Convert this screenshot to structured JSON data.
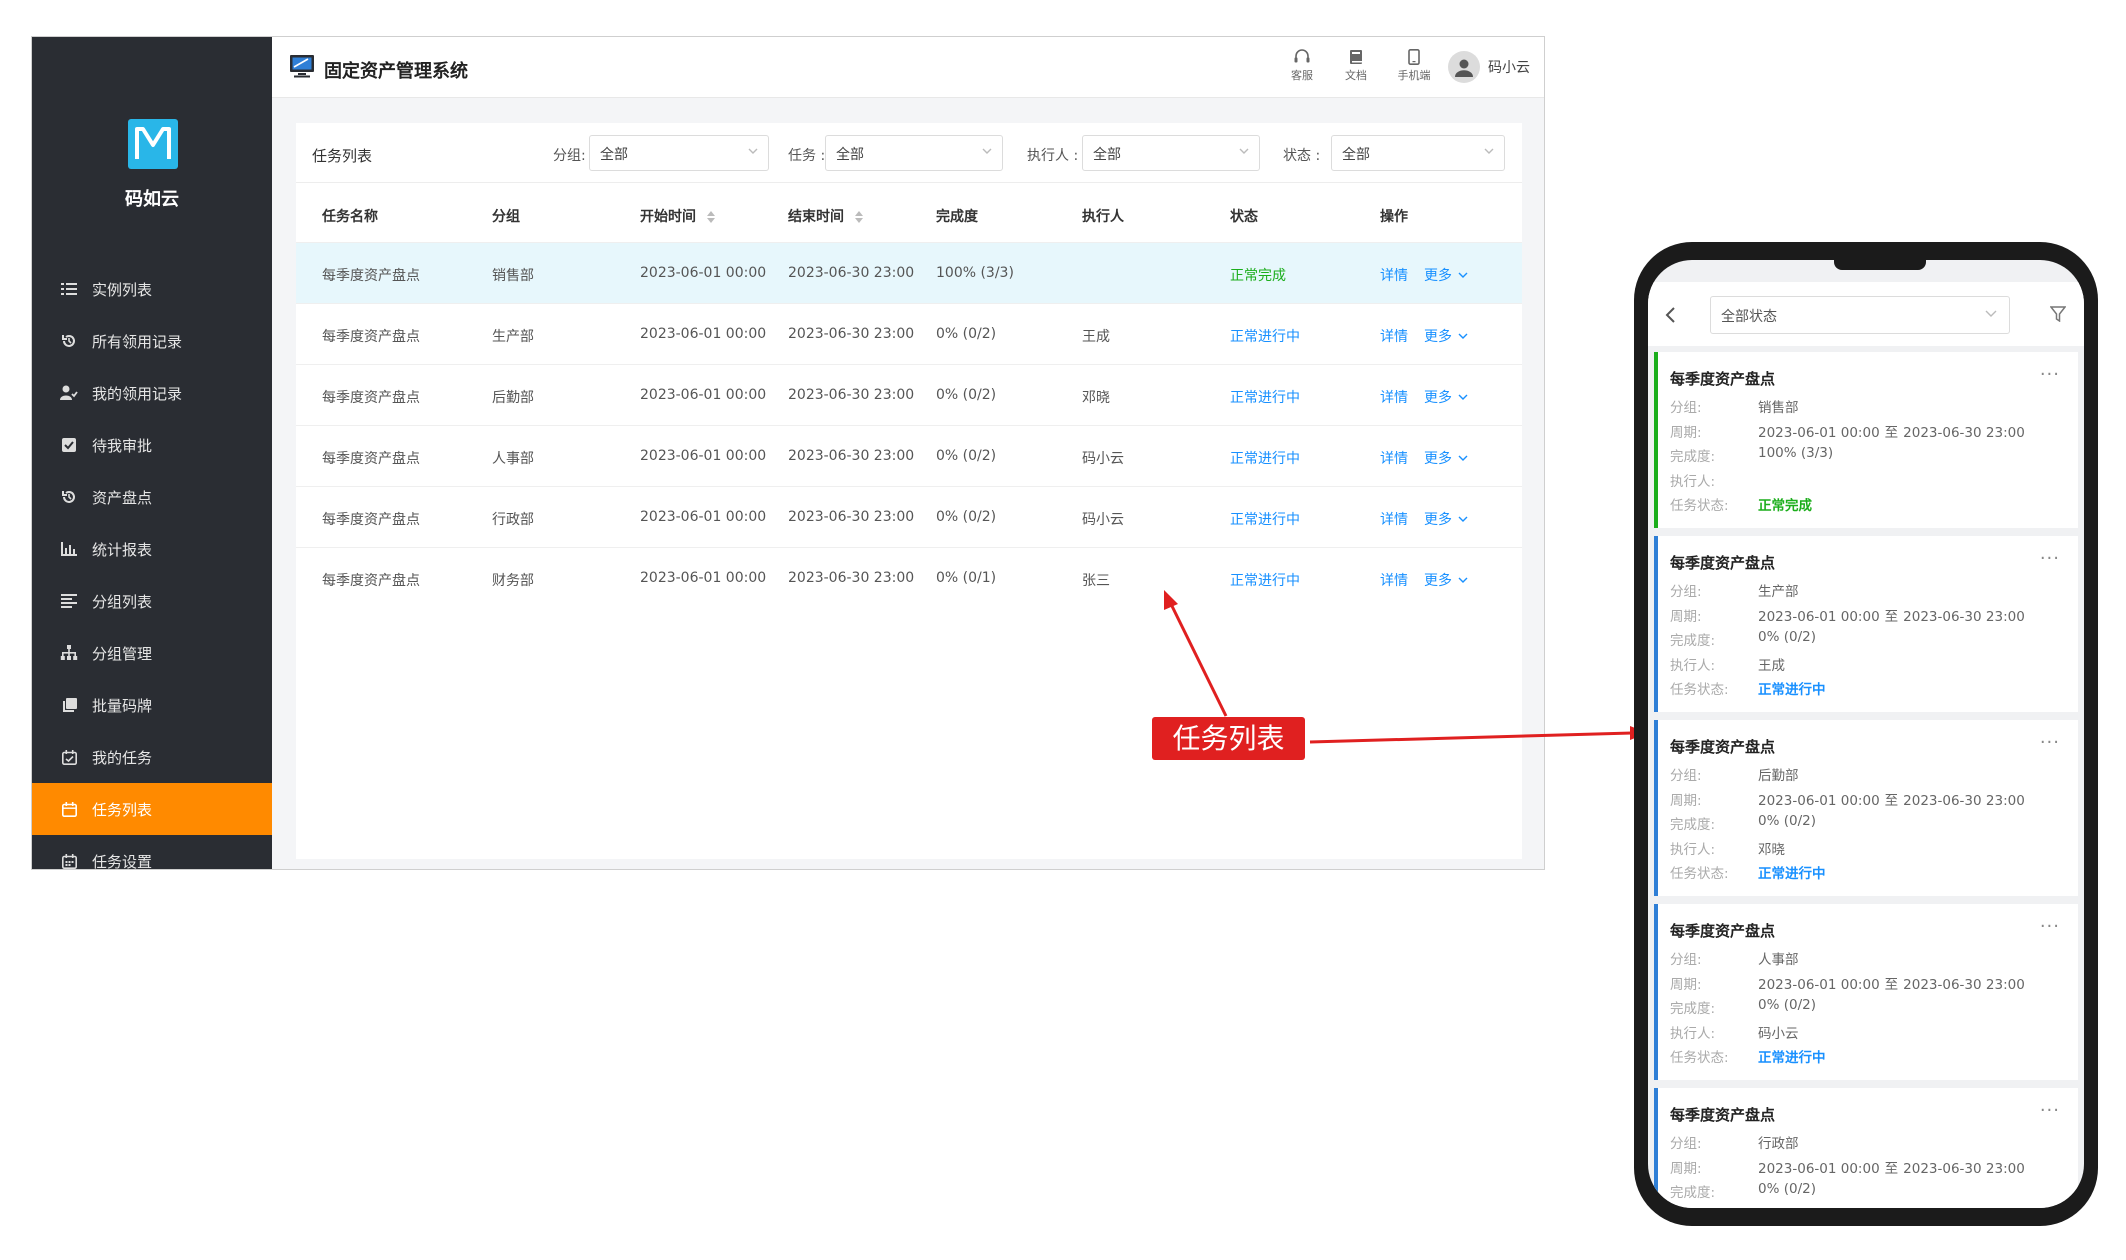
{
  "app": {
    "title": "固定资产管理系统",
    "brand": "码如云",
    "logo_letter": "M",
    "accent": "#ff8a00",
    "sidebar_bg": "#2a2d33",
    "logo_bg": "#29b6e8"
  },
  "topbar": {
    "service_label": "客服",
    "docs_label": "文档",
    "mobile_label": "手机端",
    "user_name": "码小云"
  },
  "sidebar": {
    "items": [
      {
        "label": "实例列表",
        "icon": "list-icon"
      },
      {
        "label": "所有领用记录",
        "icon": "history-icon"
      },
      {
        "label": "我的领用记录",
        "icon": "user-check-icon"
      },
      {
        "label": "待我审批",
        "icon": "checkbox-icon"
      },
      {
        "label": "资产盘点",
        "icon": "history-icon"
      },
      {
        "label": "统计报表",
        "icon": "bar-chart-icon"
      },
      {
        "label": "分组列表",
        "icon": "align-icon"
      },
      {
        "label": "分组管理",
        "icon": "org-tree-icon"
      },
      {
        "label": "批量码牌",
        "icon": "copy-icon"
      },
      {
        "label": "我的任务",
        "icon": "calendar-check-icon"
      },
      {
        "label": "任务列表",
        "icon": "calendar-icon",
        "active": true
      },
      {
        "label": "任务设置",
        "icon": "calendar-grid-icon"
      }
    ]
  },
  "filters": {
    "panel_title": "任务列表",
    "group_label": "分组:",
    "group_value": "全部",
    "task_label": "任务 :",
    "task_value": "全部",
    "executor_label": "执行人 :",
    "executor_value": "全部",
    "status_label": "状态 :",
    "status_value": "全部"
  },
  "table": {
    "columns": [
      "任务名称",
      "分组",
      "开始时间",
      "结束时间",
      "完成度",
      "执行人",
      "状态",
      "操作"
    ],
    "detail_label": "详情",
    "more_label": "更多",
    "rows": [
      {
        "name": "每季度资产盘点",
        "group": "销售部",
        "start": "2023-06-01 00:00",
        "end": "2023-06-30 23:00",
        "progress": "100%  (3/3)",
        "executor": "",
        "status": "正常完成",
        "status_type": "done"
      },
      {
        "name": "每季度资产盘点",
        "group": "生产部",
        "start": "2023-06-01 00:00",
        "end": "2023-06-30 23:00",
        "progress": "0%  (0/2)",
        "executor": "王成",
        "status": "正常进行中",
        "status_type": "run"
      },
      {
        "name": "每季度资产盘点",
        "group": "后勤部",
        "start": "2023-06-01 00:00",
        "end": "2023-06-30 23:00",
        "progress": "0%  (0/2)",
        "executor": "邓晓",
        "status": "正常进行中",
        "status_type": "run"
      },
      {
        "name": "每季度资产盘点",
        "group": "人事部",
        "start": "2023-06-01 00:00",
        "end": "2023-06-30 23:00",
        "progress": "0%  (0/2)",
        "executor": "码小云",
        "status": "正常进行中",
        "status_type": "run"
      },
      {
        "name": "每季度资产盘点",
        "group": "行政部",
        "start": "2023-06-01 00:00",
        "end": "2023-06-30 23:00",
        "progress": "0%  (0/2)",
        "executor": "码小云",
        "status": "正常进行中",
        "status_type": "run"
      },
      {
        "name": "每季度资产盘点",
        "group": "财务部",
        "start": "2023-06-01 00:00",
        "end": "2023-06-30 23:00",
        "progress": "0%  (0/1)",
        "executor": "张三",
        "status": "正常进行中",
        "status_type": "run"
      }
    ]
  },
  "callout": {
    "text": "任务列表",
    "color": "#e02020"
  },
  "mobile": {
    "status_filter": "全部状态",
    "field_labels": {
      "group": "分组:",
      "period": "周期:",
      "progress": "完成度:",
      "executor": "执行人:",
      "status": "任务状态:"
    },
    "period_sep": "至",
    "cards": [
      {
        "title": "每季度资产盘点",
        "group": "销售部",
        "start": "2023-06-01 00:00",
        "end": "2023-06-30 23:00",
        "progress": "100%  (3/3)",
        "executor": "",
        "status": "正常完成",
        "status_type": "done"
      },
      {
        "title": "每季度资产盘点",
        "group": "生产部",
        "start": "2023-06-01 00:00",
        "end": "2023-06-30 23:00",
        "progress": "0%  (0/2)",
        "executor": "王成",
        "status": "正常进行中",
        "status_type": "run"
      },
      {
        "title": "每季度资产盘点",
        "group": "后勤部",
        "start": "2023-06-01 00:00",
        "end": "2023-06-30 23:00",
        "progress": "0%  (0/2)",
        "executor": "邓晓",
        "status": "正常进行中",
        "status_type": "run"
      },
      {
        "title": "每季度资产盘点",
        "group": "人事部",
        "start": "2023-06-01 00:00",
        "end": "2023-06-30 23:00",
        "progress": "0%  (0/2)",
        "executor": "码小云",
        "status": "正常进行中",
        "status_type": "run"
      },
      {
        "title": "每季度资产盘点",
        "group": "行政部",
        "start": "2023-06-01 00:00",
        "end": "2023-06-30 23:00",
        "progress": "0%  (0/2)",
        "executor": "",
        "status": "",
        "status_type": "run"
      }
    ]
  }
}
